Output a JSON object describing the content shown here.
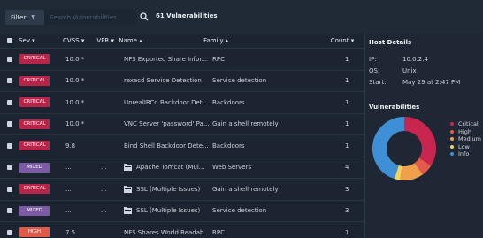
{
  "toolbar": {
    "filter_label": "Filter",
    "search_placeholder": "Search Vulnerabilities",
    "vuln_count": "61 Vulnerabilities"
  },
  "table": {
    "columns": {
      "sev": "Sev ▾",
      "cvss": "CVSS ▾",
      "vpr": "VPR ▾",
      "name": "Name ▴",
      "family": "Family ▴",
      "count": "Count ▾"
    },
    "rows": [
      {
        "severity": "CRITICAL",
        "cvss": "10.0 *",
        "vpr": "",
        "name": "NFS Exported Share Infor...",
        "family": "RPC",
        "count": "1",
        "folder": false
      },
      {
        "severity": "CRITICAL",
        "cvss": "10.0 *",
        "vpr": "",
        "name": "rexecd Service Detection",
        "family": "Service detection",
        "count": "1",
        "folder": false
      },
      {
        "severity": "CRITICAL",
        "cvss": "10.0 *",
        "vpr": "",
        "name": "UnrealIRCd Backdoor Det...",
        "family": "Backdoors",
        "count": "1",
        "folder": false
      },
      {
        "severity": "CRITICAL",
        "cvss": "10.0 *",
        "vpr": "",
        "name": "VNC Server 'password' Pa...",
        "family": "Gain a shell remotely",
        "count": "1",
        "folder": false
      },
      {
        "severity": "CRITICAL",
        "cvss": "9.8",
        "vpr": "",
        "name": "Bind Shell Backdoor Dete...",
        "family": "Backdoors",
        "count": "1",
        "folder": false
      },
      {
        "severity": "MIXED",
        "cvss": "...",
        "vpr": "...",
        "name": "Apache Tomcat (Mul...",
        "family": "Web Servers",
        "count": "4",
        "folder": true
      },
      {
        "severity": "CRITICAL",
        "cvss": "...",
        "vpr": "...",
        "name": "SSL (Multiple Issues)",
        "family": "Gain a shell remotely",
        "count": "3",
        "folder": true
      },
      {
        "severity": "MIXED",
        "cvss": "...",
        "vpr": "...",
        "name": "SSL (Multiple Issues)",
        "family": "Service detection",
        "count": "3",
        "folder": true
      },
      {
        "severity": "HIGH",
        "cvss": "7.5",
        "vpr": "",
        "name": "NFS Shares World Readab...",
        "family": "RPC",
        "count": "1",
        "folder": false
      }
    ]
  },
  "severity_colors": {
    "CRITICAL": "#b8254a",
    "MIXED": "#7c5aa6",
    "HIGH": "#e05a4a"
  },
  "host_details": {
    "title": "Host Details",
    "ip_label": "IP:",
    "ip_value": "10.0.2.4",
    "os_label": "OS:",
    "os_value": "Unix",
    "start_label": "Start:",
    "start_value": "May 29 at 2:47 PM"
  },
  "vulnerabilities_panel": {
    "title": "Vulnerabilities",
    "legend": [
      {
        "label": "Critical",
        "color": "#c8264f"
      },
      {
        "label": "High",
        "color": "#e45b4b"
      },
      {
        "label": "Medium",
        "color": "#f0a04b"
      },
      {
        "label": "Low",
        "color": "#f3d35b"
      },
      {
        "label": "Info",
        "color": "#3f8fd6"
      }
    ],
    "donut_fractions": [
      0.34,
      0.06,
      0.12,
      0.03,
      0.45
    ]
  }
}
